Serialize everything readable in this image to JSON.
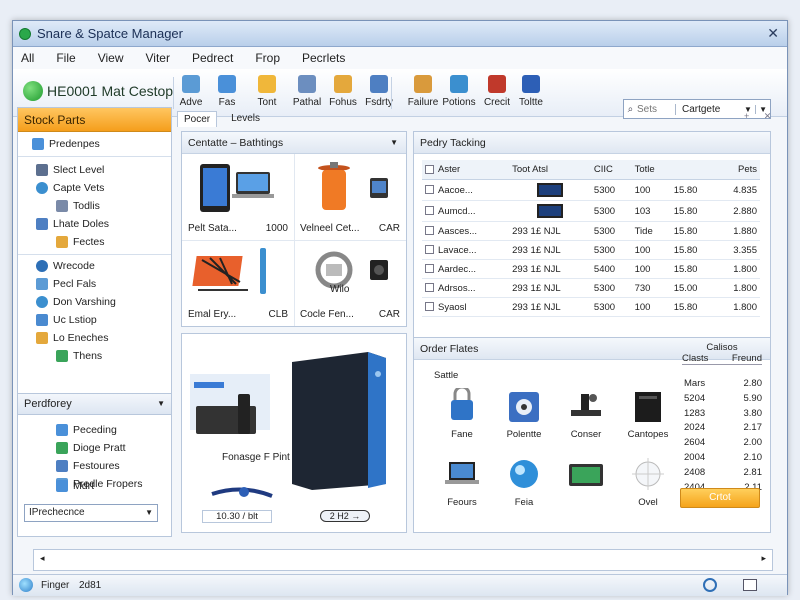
{
  "window": {
    "title": "Snare & Spatce Manager",
    "close_glyph": "✕"
  },
  "menu": [
    "All",
    "File",
    "View",
    "Viter",
    "Pedrect",
    "Frop",
    "Pecrlets"
  ],
  "toolbar": {
    "brand": "HE0001 Mat Cestop",
    "buttons": [
      {
        "label": "Adve",
        "icon": "add-document-icon",
        "color": "#5b9bd5"
      },
      {
        "label": "Fas",
        "icon": "folder-icon",
        "color": "#4a90d9"
      },
      {
        "label": "Tont",
        "icon": "document-icon",
        "color": "#f0b73a"
      },
      {
        "label": "Pathal",
        "icon": "report-icon",
        "color": "#6c8ebf"
      },
      {
        "label": "Fohus",
        "icon": "files-icon",
        "color": "#e4a83c"
      },
      {
        "label": "Fsdrty",
        "icon": "chart-doc-icon",
        "color": "#4e7fc2"
      },
      {
        "label": "Failure",
        "icon": "wrench-icon",
        "color": "#d99a3c"
      },
      {
        "label": "Potions",
        "icon": "globe-icon",
        "color": "#3b8fcf"
      },
      {
        "label": "Crecit",
        "icon": "media-icon",
        "color": "#c0392b"
      },
      {
        "label": "Toltte",
        "icon": "facebook-icon",
        "color": "#2d5fb6"
      }
    ],
    "search": {
      "placeholder": "Sets",
      "category": "Cartgete"
    }
  },
  "sidebar": {
    "header": "Stock Parts",
    "items": [
      {
        "label": "Predenpes",
        "icon": "list-icon",
        "color": "#4a90d9"
      },
      {
        "label": "Slect Level",
        "icon": "gear-icon",
        "color": "#5c6f8f"
      },
      {
        "label": "Capte Vets",
        "icon": "globe-icon",
        "color": "#3b8fcf"
      },
      {
        "label": "Todlis",
        "icon": "tools-icon",
        "color": "#7a8aa8"
      },
      {
        "label": "Lhate Doles",
        "icon": "grid-icon",
        "color": "#4e7fc2"
      },
      {
        "label": "Fectes",
        "icon": "folder-icon",
        "color": "#e4a83c"
      },
      {
        "label": "Wrecode",
        "icon": "globe-icon",
        "color": "#2d6fb6"
      },
      {
        "label": "Pecl Fals",
        "icon": "list-icon",
        "color": "#5c9bd5"
      },
      {
        "label": "Don Varshing",
        "icon": "globe-icon",
        "color": "#3b8fcf"
      },
      {
        "label": "Uc Lstiop",
        "icon": "settings-icon",
        "color": "#4a8ad0"
      },
      {
        "label": "Lo Eneches",
        "icon": "folder-icon",
        "color": "#e4a83c"
      },
      {
        "label": "Thens",
        "icon": "tree-icon",
        "color": "#3aa45a"
      }
    ],
    "section2": "Perdforey",
    "items2": [
      {
        "label": "Peceding",
        "icon": "doc-icon",
        "color": "#4a90d9"
      },
      {
        "label": "Dioge Pratt",
        "icon": "box-icon",
        "color": "#3aa45a"
      },
      {
        "label": "Festoures",
        "icon": "list-icon",
        "color": "#4e7fc2"
      },
      {
        "label": "Predle Fropers",
        "icon": "tag-icon",
        "color": "#5c9bd5"
      },
      {
        "label": "Mdrt",
        "icon": "chart-icon",
        "color": "#4a90d9"
      }
    ],
    "select": "IPrechecnce"
  },
  "tabs": [
    "Pocer",
    "Levels"
  ],
  "tab_icons": "+ ✕",
  "catalog": {
    "title": "Centatte – Bathtings",
    "products": [
      {
        "name": "Pelt Sata...",
        "code": "1000",
        "kind": "tablet"
      },
      {
        "name": "Velneel Cet...",
        "code": "CAR",
        "kind": "tank"
      },
      {
        "name": "Emal Ery...",
        "code": "CLB",
        "kind": "board"
      },
      {
        "name": "Cocle Fen...",
        "code": "CAR",
        "kind": "cable"
      }
    ],
    "wide_title": "Wilo"
  },
  "tracking": {
    "title": "Pedry Tacking",
    "columns": [
      "Aster",
      "Toot Atsl",
      "CIIC",
      "Totle",
      "",
      "Pets"
    ],
    "rows": [
      {
        "name": "Aacoe...",
        "ref": "",
        "c1": "5300",
        "c2": "100",
        "c3": "15.80",
        "c4": "4.835"
      },
      {
        "name": "Aumcd...",
        "ref": "",
        "c1": "5300",
        "c2": "103",
        "c3": "15.80",
        "c4": "2.880"
      },
      {
        "name": "Aasces...",
        "ref": "293 1£ NJL",
        "c1": "5300",
        "c2": "Tide",
        "c3": "15.80",
        "c4": "1.880"
      },
      {
        "name": "Lavace...",
        "ref": "293 1£ NJL",
        "c1": "5300",
        "c2": "100",
        "c3": "15.80",
        "c4": "3.355"
      },
      {
        "name": "Aardec...",
        "ref": "293 1£ NJL",
        "c1": "5400",
        "c2": "100",
        "c3": "15.80",
        "c4": "1.800"
      },
      {
        "name": "Adrsos...",
        "ref": "293 1£ NJL",
        "c1": "5300",
        "c2": "730",
        "c3": "15.00",
        "c4": "1.800"
      },
      {
        "name": "Syaosl",
        "ref": "293 1£ NJL",
        "c1": "5300",
        "c2": "100",
        "c3": "15.80",
        "c4": "1.800"
      }
    ]
  },
  "feature": {
    "label_left": "10.30 / blt",
    "label_right": "2 H2 →",
    "caption": "Fonasge F Pint"
  },
  "orders": {
    "title": "Order Flates",
    "subtitle": "Sattle",
    "head": {
      "top": "Calisos",
      "c1": "Clasts",
      "c2": "Freund"
    },
    "rows": [
      {
        "a": "Mars",
        "b": "2.80"
      },
      {
        "a": "5204",
        "b": "5.90"
      },
      {
        "a": "1283",
        "b": "3.80"
      },
      {
        "a": "2024",
        "b": "2.17"
      },
      {
        "a": "2604",
        "b": "2.00"
      },
      {
        "a": "2004",
        "b": "2.10"
      },
      {
        "a": "2408",
        "b": "2.81"
      },
      {
        "a": "2404",
        "b": "2.11"
      }
    ],
    "button": "Crtot",
    "items": [
      {
        "label": "Fane",
        "kind": "lock"
      },
      {
        "label": "Polentte",
        "kind": "drive"
      },
      {
        "label": "Conser",
        "kind": "press"
      },
      {
        "label": "Cantopes",
        "kind": "box"
      },
      {
        "label": "Feours",
        "kind": "laptop"
      },
      {
        "label": "Feia",
        "kind": "orb"
      },
      {
        "label": "",
        "kind": "gps"
      },
      {
        "label": "Ovel",
        "kind": "ball"
      }
    ]
  },
  "bottombar": {
    "left": "◂",
    "right": "▸"
  },
  "status": {
    "items": [
      "Finger",
      "2d81"
    ]
  }
}
